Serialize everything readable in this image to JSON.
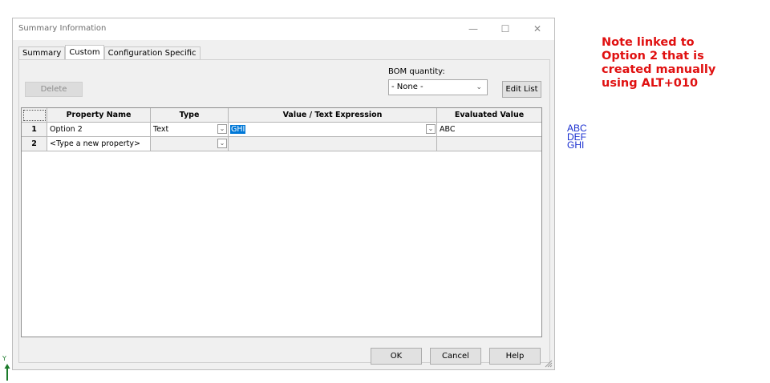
{
  "dialog": {
    "title": "Summary Information",
    "window_controls": {
      "minimize": "—",
      "maximize": "☐",
      "close": "✕"
    },
    "tabs": [
      "Summary",
      "Custom",
      "Configuration Specific"
    ],
    "active_tab": "Custom",
    "delete_label": "Delete",
    "bom_label": "BOM quantity:",
    "bom_value": "- None -",
    "edit_list_label": "Edit List",
    "table": {
      "headers": [
        "Property Name",
        "Type",
        "Value / Text Expression",
        "Evaluated Value"
      ],
      "rows": [
        {
          "num": "1",
          "name": "Option 2",
          "type": "Text",
          "value": "GHI",
          "evaluated": "ABC"
        },
        {
          "num": "2",
          "name": "<Type a new property>",
          "type": "",
          "value": "",
          "evaluated": ""
        }
      ]
    },
    "ok_label": "OK",
    "cancel_label": "Cancel",
    "help_label": "Help"
  },
  "note": {
    "lines": [
      "Note linked to",
      "Option 2 that is",
      "created manually",
      "using ALT+010"
    ],
    "color": "#e01010"
  },
  "drawing_text": [
    "ABC",
    "DEF",
    "GHI"
  ],
  "axis_label": "Y"
}
